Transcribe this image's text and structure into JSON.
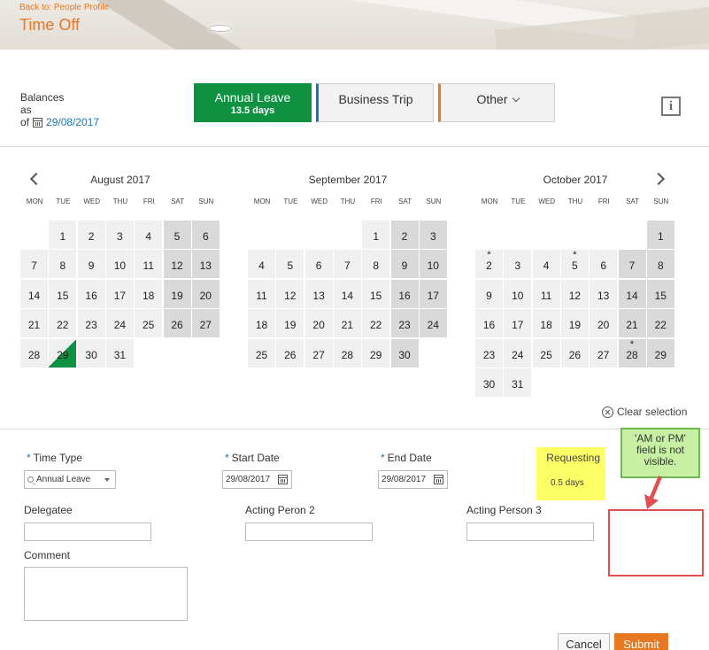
{
  "header": {
    "back_link": "Back to: People Profile",
    "title": "Time Off"
  },
  "balances": {
    "line1": "Balances",
    "line2": "as",
    "line3": "of",
    "date": "29/08/2017"
  },
  "tabs": {
    "annual_label": "Annual Leave",
    "annual_days": "13.5 days",
    "business_label": "Business Trip",
    "other_label": "Other"
  },
  "info_label": "i",
  "calendar": {
    "dow": [
      "MON",
      "TUE",
      "WED",
      "THU",
      "FRI",
      "SAT",
      "SUN"
    ],
    "months": [
      {
        "title": "August 2017",
        "offset": 1,
        "days": 31,
        "selected": [
          29
        ],
        "starred": []
      },
      {
        "title": "September 2017",
        "offset": 4,
        "days": 30,
        "selected": [],
        "starred": []
      },
      {
        "title": "October 2017",
        "offset": 6,
        "days": 31,
        "selected": [],
        "starred": [
          2,
          5,
          28
        ]
      }
    ],
    "clear_label": "Clear selection"
  },
  "form": {
    "time_type_label": "Time Type",
    "time_type_value": "Annual Leave",
    "start_date_label": "Start Date",
    "start_date_value": "29/08/2017",
    "end_date_label": "End Date",
    "end_date_value": "29/08/2017",
    "requesting_label": "Requesting",
    "requesting_value": "0.5 days",
    "delegatee_label": "Delegatee",
    "acting2_label": "Acting Peron 2",
    "acting3_label": "Acting Person 3",
    "comment_label": "Comment"
  },
  "buttons": {
    "cancel": "Cancel",
    "submit": "Submit"
  },
  "annotation": {
    "line1": "'AM or PM'",
    "line2": "field is not",
    "line3": "visible."
  },
  "colors": {
    "accent_orange": "#e87722",
    "annual_green": "#0e9140",
    "link_blue": "#1a73b8",
    "annotation_red": "#e05050",
    "note_green": "#c8f0a4",
    "highlight_yellow": "#ffff66"
  }
}
